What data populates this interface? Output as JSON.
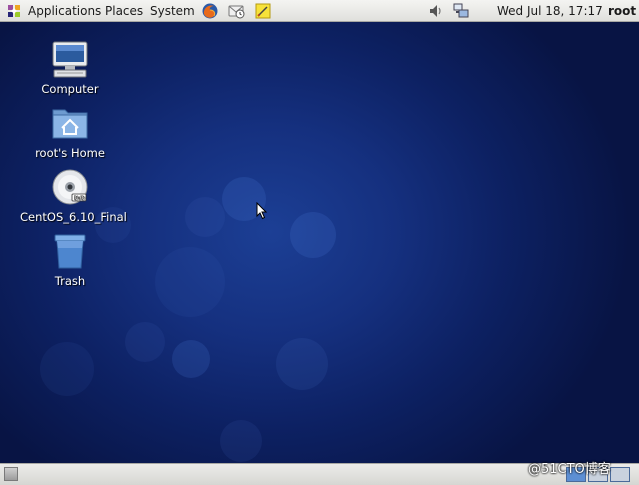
{
  "top_panel": {
    "menus": [
      "Applications",
      "Places",
      "System"
    ],
    "launchers": [
      "firefox-icon",
      "mail-clock-icon",
      "notes-icon"
    ],
    "clock": "Wed Jul 18, 17:17",
    "user": "root",
    "tray": [
      "volume-icon",
      "network-icon"
    ]
  },
  "desktop": {
    "icons": [
      {
        "label": "Computer",
        "icon": "computer-icon"
      },
      {
        "label": "root's Home",
        "icon": "home-folder-icon"
      },
      {
        "label": "CentOS_6.10_Final",
        "icon": "dvd-icon"
      },
      {
        "label": "Trash",
        "icon": "trash-icon"
      }
    ]
  },
  "bottom_panel": {
    "workspaces": 4,
    "active_workspace": 1
  },
  "watermark": "@51CTO博客",
  "colors": {
    "desktop_bg": "#15307f",
    "panel_bg": "#e8e8e4",
    "accent": "#3c6fc7"
  }
}
